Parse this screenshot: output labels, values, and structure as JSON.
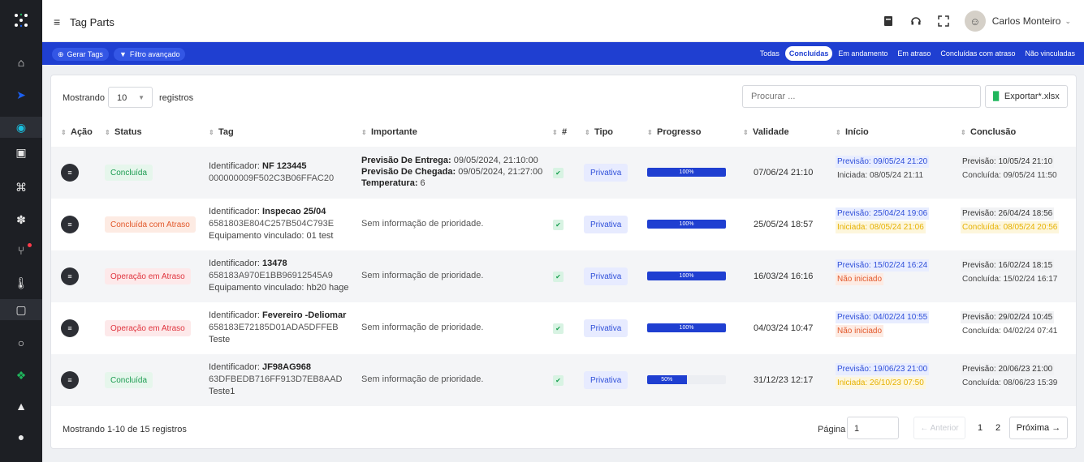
{
  "topbar": {
    "menu_icon": "hamburger-icon",
    "title": "Tag Parts",
    "user_name": "Carlos Monteiro"
  },
  "toolbar": {
    "generate_label": "Gerar Tags",
    "filter_label": "Filtro avançado",
    "filters": [
      "Todas",
      "Concluídas",
      "Em andamento",
      "Em atraso",
      "Concluídas com atraso",
      "Não vinculadas"
    ],
    "selected_filter": "Concluídas"
  },
  "table_controls": {
    "showing_label": "Mostrando",
    "page_size": "10",
    "records_label": "registros",
    "search_placeholder": "Procurar ...",
    "export_label": "Exportar*.xlsx"
  },
  "columns": [
    "Ação",
    "Status",
    "Tag",
    "Importante",
    "#",
    "Tipo",
    "Progresso",
    "Validade",
    "Início",
    "Conclusão"
  ],
  "rows": [
    {
      "status": "Concluída",
      "tag_prefix": "Identificador: ",
      "tag_id": "NF 123445",
      "tag_code": "000000009F502C3B06FFAC20",
      "tag_extra": "",
      "imp1_label": "Previsão De Entrega:",
      "imp1_value": " 09/05/2024, 21:10:00",
      "imp2_label": "Previsão De Chegada:",
      "imp2_value": " 09/05/2024, 21:27:00",
      "imp3_label": "Temperatura:",
      "imp3_value": " 6",
      "tipo": "Privativa",
      "progress": 100,
      "progress_label": "100%",
      "validade": "07/06/24 21:10",
      "inicio_prev": "Previsão: 09/05/24 21:20",
      "inicio_real": "Iniciada: 08/05/24 21:11",
      "conc_prev": "Previsão: 10/05/24 21:10",
      "conc_real": "Concluída: 09/05/24 11:50"
    },
    {
      "status": "Concluída com Atraso",
      "tag_prefix": "Identificador: ",
      "tag_id": "Inspecao 25/04",
      "tag_code": "6581803E804C257B504C793E",
      "tag_extra": "Equipamento vinculado: 01 test",
      "imp_text": "Sem informação de prioridade.",
      "tipo": "Privativa",
      "progress": 100,
      "progress_label": "100%",
      "validade": "25/05/24 18:57",
      "inicio_prev": "Previsão: 25/04/24 19:06",
      "inicio_real": "Iniciada: 08/05/24 21:06",
      "conc_prev": "Previsão: 26/04/24 18:56",
      "conc_real": "Concluída: 08/05/24 20:56"
    },
    {
      "status": "Operação em Atraso",
      "tag_prefix": "Identificador: ",
      "tag_id": "13478",
      "tag_code": "658183A970E1BB96912545A9",
      "tag_extra": "Equipamento vinculado: hb20 hage",
      "imp_text": "Sem informação de prioridade.",
      "tipo": "Privativa",
      "progress": 100,
      "progress_label": "100%",
      "validade": "16/03/24 16:16",
      "inicio_prev": "Previsão: 15/02/24 16:24",
      "inicio_real": "Não iniciado",
      "conc_prev": "Previsão: 16/02/24 18:15",
      "conc_real": "Concluída: 15/02/24 16:17"
    },
    {
      "status": "Operação em Atraso",
      "tag_prefix": "Identificador: ",
      "tag_id": "Fevereiro -Deliomar",
      "tag_code": "658183E72185D01ADA5DFFEB",
      "tag_extra": "Teste",
      "imp_text": "Sem informação de prioridade.",
      "tipo": "Privativa",
      "progress": 100,
      "progress_label": "100%",
      "validade": "04/03/24 10:47",
      "inicio_prev": "Previsão: 04/02/24 10:55",
      "inicio_real": "Não iniciado",
      "conc_prev": "Previsão: 29/02/24 10:45",
      "conc_real": "Concluída: 04/02/24 07:41"
    },
    {
      "status": "Concluída",
      "tag_prefix": "Identificador: ",
      "tag_id": "JF98AG968",
      "tag_code": "63DFBEDB716FF913D7EB8AAD",
      "tag_extra": "Teste1",
      "imp_text": "Sem informação de prioridade.",
      "tipo": "Privativa",
      "progress": 50,
      "progress_label": "50%",
      "validade": "31/12/23 12:17",
      "inicio_prev": "Previsão: 19/06/23 21:00",
      "inicio_real": "Iniciada: 26/10/23 07:50",
      "conc_prev": "Previsão: 20/06/23 21:00",
      "conc_real": "Concluída: 08/06/23 15:39"
    }
  ],
  "footer": {
    "showing": "Mostrando 1-10 de 15 registros",
    "page_label": "Página",
    "page_value": "1",
    "prev_label": "← Anterior",
    "pages": [
      "1",
      "2"
    ],
    "next_label": "Próxima →"
  },
  "colors": {
    "brand_blue": "#1f3fd1",
    "sidebar": "#1d1f24",
    "success": "#1d9c52",
    "warning": "#e6b100",
    "danger": "#e0353f"
  }
}
